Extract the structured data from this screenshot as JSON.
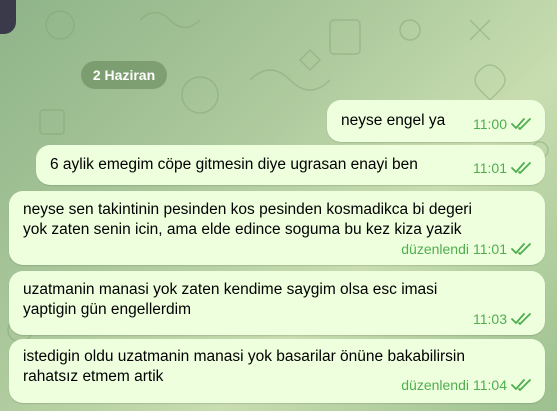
{
  "date_separator": "2 Haziran",
  "messages": [
    {
      "text": "neyse engel ya",
      "status": "",
      "time": "11:00"
    },
    {
      "text": "6 aylik emegim cöpe gitmesin diye ugrasan enayi ben",
      "status": "",
      "time": "11:01"
    },
    {
      "text": "neyse sen takintinin pesinden kos pesinden kosmadikca bi degeri\nyok zaten senin icin, ama elde edince soguma bu kez kiza yazik",
      "status": "düzenlendi",
      "time": "11:01"
    },
    {
      "text": "uzatmanin manasi yok zaten kendime saygim olsa esc imasi\nyaptigin gün engellerdim",
      "status": "",
      "time": "11:03"
    },
    {
      "text": "istedigin oldu uzatmanin manasi yok basarilar önüne bakabilirsin\nrahatsız etmem artik",
      "status": "düzenlendi",
      "time": "11:04"
    }
  ],
  "colors": {
    "bubble": "#eeffde",
    "meta": "#4fae4e",
    "date_pill": "#6a8a5a"
  },
  "icons": {
    "read_receipt": "double-check-icon"
  }
}
